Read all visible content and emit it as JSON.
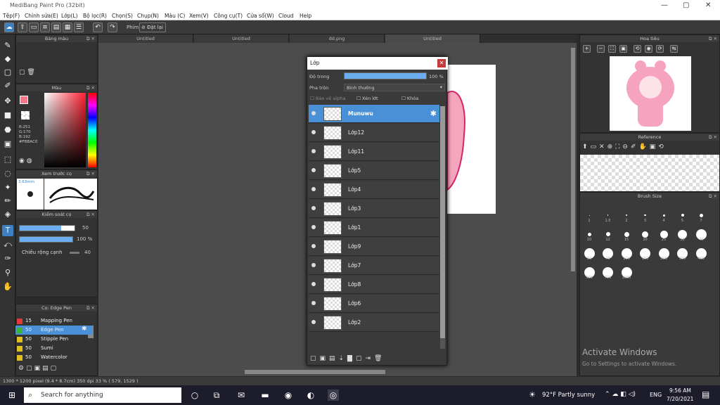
{
  "window": {
    "title": "MediBang Paint Pro (32bit)",
    "min": "—",
    "max": "▢",
    "close": "✕"
  },
  "menu": [
    "Tệp(F)",
    "Chỉnh sửa(E)",
    "Lớp(L)",
    "Bộ lọc(R)",
    "Chọn(S)",
    "Chụp(N)",
    "Màu (C)",
    "Xem(V)",
    "Công cụ(T)",
    "Cửa sổ(W)",
    "Cloud",
    "Help"
  ],
  "toolbar": {
    "pen_label": "Phím",
    "reset_label": "Đặt lại"
  },
  "tabs": [
    "Untitled",
    "Untitled",
    "dd.png",
    "Untitled"
  ],
  "panels": {
    "palette": "Bảng màu",
    "color": "Màu",
    "preview": "Xem trước cọ",
    "control": "Kiểm soát cọ",
    "brush": "Cọ: Edge Pen",
    "navigator": "Hoa tiêu",
    "reference": "Reference",
    "brushsize": "Brush Size"
  },
  "color": {
    "r": "R:251",
    "g": "G:170",
    "b": "B:192",
    "hex": "#FBBAC0",
    "fg": "#f47a8a",
    "bg": "#ffffff"
  },
  "preview": {
    "size": "3.63mm"
  },
  "control": {
    "size_value": "50",
    "opacity_value": "100 %",
    "edge_label": "Chiều rộng cạnh",
    "edge_value": "40"
  },
  "brushes": [
    {
      "size": "15",
      "name": "Mapping Pen",
      "color": "#e03b3b"
    },
    {
      "size": "50",
      "name": "Edge Pen",
      "color": "#3bb33b"
    },
    {
      "size": "50",
      "name": "Stipple Pen",
      "color": "#e0c020"
    },
    {
      "size": "50",
      "name": "Sumi",
      "color": "#e0c020"
    },
    {
      "size": "50",
      "name": "Watercolor",
      "color": "#e0c020"
    }
  ],
  "layer_dialog": {
    "title": "Lớp",
    "opacity_label": "Độ trong",
    "opacity_value": "100 %",
    "blend_label": "Pha trộn",
    "blend_value": "Bình thường",
    "protect_alpha": "Bảo vệ alpha",
    "clipping": "Xén lớt",
    "lock": "Khóa",
    "layers": [
      "Munuwu",
      "Lớp12",
      "Lớp11",
      "Lớp5",
      "Lớp4",
      "Lớp3",
      "Lớp1",
      "Lớp9",
      "Lớp7",
      "Lớp8",
      "Lớp6",
      "Lớp2"
    ]
  },
  "brush_sizes": [
    [
      "1",
      "1.5",
      "2",
      "3",
      "4",
      "5",
      "7"
    ],
    [
      "10",
      "12",
      "15",
      "20",
      "25",
      "30",
      "40"
    ],
    [
      "50",
      "70",
      "100",
      "150",
      "200",
      "300",
      "400"
    ],
    [
      "500",
      "700",
      "1000"
    ]
  ],
  "status": "1300 * 1200 pixel  (9.4 * 8.7cm)  350 dpi  33 %  ( 579, 1529 )",
  "activate": {
    "title": "Activate Windows",
    "subtitle": "Go to Settings to activate Windows."
  },
  "taskbar": {
    "search_placeholder": "Search for anything",
    "weather": "92°F  Partly sunny",
    "lang": "ENG",
    "time": "9:56 AM",
    "date": "7/20/2021"
  }
}
